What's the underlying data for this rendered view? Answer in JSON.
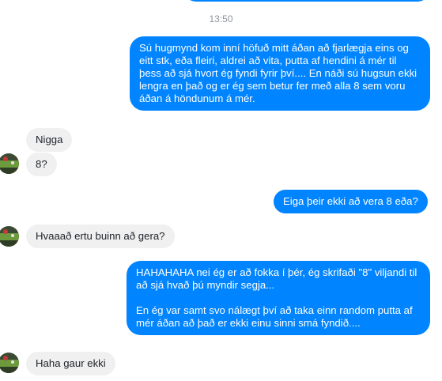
{
  "chat": {
    "timestamp": "13:50",
    "messages": [
      {
        "from": "me",
        "text": "Sú hugmynd kom inní höfuð mitt áðan að fjarlægja eins og eitt stk, eða fleiri, aldrei að vita, putta af hendini á mér til þess að sjá hvort ég fyndi fyrir því.... En náði sú hugsun ekki lengra en það og er ég sem betur fer með alla 8 sem voru áðan á höndunum á mér."
      },
      {
        "from": "them",
        "text": "Nigga"
      },
      {
        "from": "them",
        "text": "8?"
      },
      {
        "from": "me",
        "text": "Eiga þeir ekki að vera 8 eða?"
      },
      {
        "from": "them",
        "text": "Hvaaað ertu buinn að gera?"
      },
      {
        "from": "me",
        "text": "HAHAHAHA nei ég er að fokka í þér, ég skrifaði \"8\" viljandi til að sjá hvað þú myndir segja...\n\nEn ég var samt svo nálægt því að taka einn random putta af mér áðan að það er ekki einu sinni smá fyndið...."
      },
      {
        "from": "them",
        "text": "Haha gaur ekki"
      }
    ]
  },
  "colors": {
    "outgoing_bubble": "#0084ff",
    "incoming_bubble": "#f1f0f0",
    "timestamp_text": "#90949c"
  },
  "icons": {
    "avatar": "contact-avatar-photo"
  }
}
